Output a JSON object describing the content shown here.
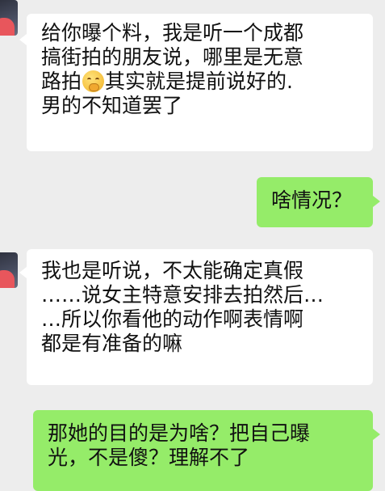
{
  "messages": [
    {
      "side": "incoming",
      "lines": [
        "给你曝个料，我是听一个成都",
        "搞街拍的朋友说，哪里是无意",
        "路拍",
        "其实就是提前说好的.",
        "男的不知道罢了"
      ],
      "emoji": "thinking-face-emoji"
    },
    {
      "side": "outgoing",
      "lines": [
        "啥情况？"
      ]
    },
    {
      "side": "incoming",
      "lines": [
        "我也是听说，不太能确定真假",
        "……说女主特意安排去拍然后…",
        "…所以你看他的动作啊表情啊",
        "都是有准备的嘛"
      ]
    },
    {
      "side": "outgoing",
      "lines": [
        "那她的目的是为啥？把自己曝",
        "光，不是傻？理解不了"
      ]
    }
  ],
  "colors": {
    "background": "#ededed",
    "incoming_bubble": "#ffffff",
    "outgoing_bubble": "#95ec69"
  }
}
